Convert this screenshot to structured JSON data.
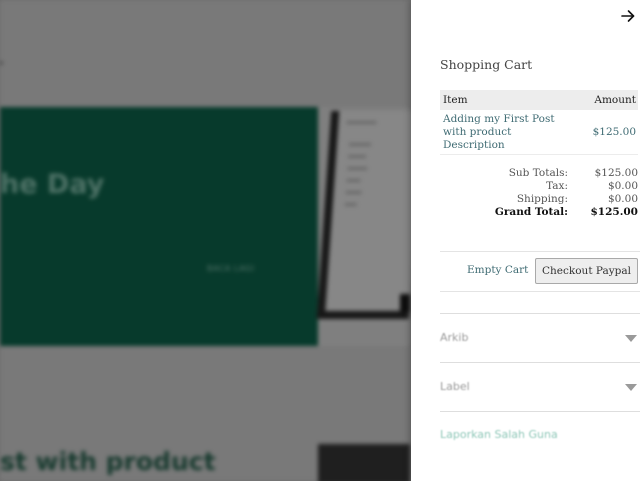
{
  "background": {
    "hero_title": "he Day",
    "hero_button": "BACA LAGI",
    "post_title": "st with product"
  },
  "drawer": {
    "close_icon": "arrow-right-icon",
    "title": "Shopping Cart",
    "table": {
      "headers": [
        "Item",
        "Amount"
      ],
      "items": [
        {
          "name": "Adding my First Post with product Description",
          "amount": "$125.00"
        }
      ]
    },
    "totals": [
      {
        "label": "Sub Totals:",
        "value": "$125.00"
      },
      {
        "label": "Tax:",
        "value": "$0.00"
      },
      {
        "label": "Shipping:",
        "value": "$0.00"
      },
      {
        "label": "Grand Total:",
        "value": "$125.00"
      }
    ],
    "empty_cart_label": "Empty Cart",
    "checkout_label": "Checkout Paypal",
    "accordion": [
      {
        "label": "Arkib",
        "chevron_icon": "chevron-down-icon"
      },
      {
        "label": "Label",
        "chevron_icon": "chevron-down-icon"
      }
    ],
    "report_link": "Laporkan Salah Guna"
  },
  "colors": {
    "hero_green": "#0e6a50",
    "link_teal": "#3f6b73",
    "overlay": "rgba(0,0,0,0.45)"
  }
}
